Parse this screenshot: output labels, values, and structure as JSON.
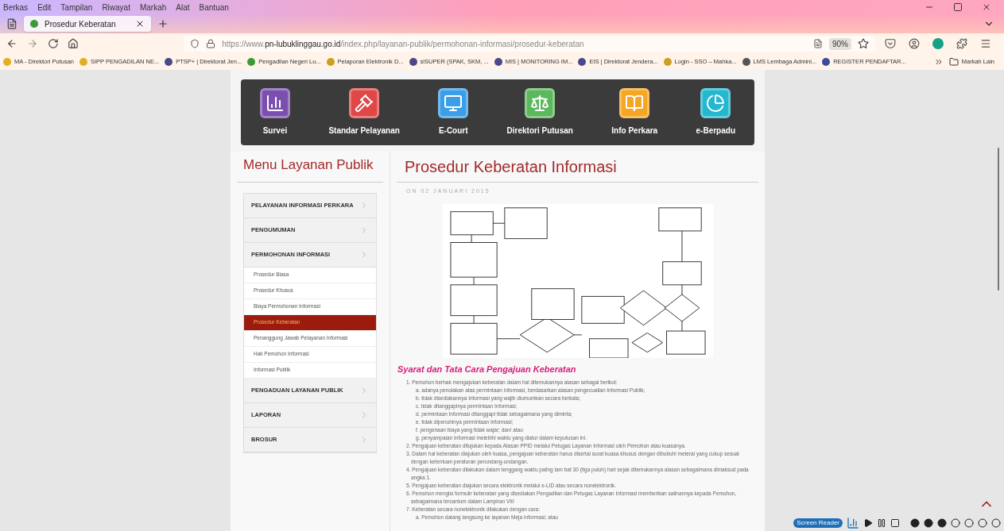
{
  "browser": {
    "menu_bar": [
      "Berkas",
      "Edit",
      "Tampilan",
      "Riwayat",
      "Markah",
      "Alat",
      "Bantuan"
    ],
    "tab": {
      "title": "Prosedur Keberatan",
      "selected": true
    },
    "url": {
      "scheme": "https://www.",
      "host": "pn-lubuklinggau.go.id",
      "path": "/index.php/layanan-publik/permohonan-informasi/prosedur-keberatan"
    },
    "zoom": "90%",
    "bookmarks": [
      {
        "label": "MA - Direktori Putusan",
        "color": "#e0b020"
      },
      {
        "label": "SIPP PENGADILAN NE...",
        "color": "#e0b020"
      },
      {
        "label": "PTSP+ | Direktorat Jen...",
        "color": "#4a4a8a"
      },
      {
        "label": "Pengadilan Negeri Lu...",
        "color": "#3a9a3a"
      },
      {
        "label": "Pelaporan Elektronik D...",
        "color": "#c9a020"
      },
      {
        "label": "siSUPER (SPAK, SKM, ...",
        "color": "#4a4a8a"
      },
      {
        "label": "MIS | MONITORING IM...",
        "color": "#4a4a8a"
      },
      {
        "label": "EIS | Direktorat Jendera...",
        "color": "#4a4a8a"
      },
      {
        "label": "Login - SSO – Mahka...",
        "color": "#c9a020"
      },
      {
        "label": "LMS Lembaga Admini...",
        "color": "#555555"
      },
      {
        "label": "REGISTER PENDAFTAR...",
        "color": "#3a4aa0"
      }
    ],
    "bookmarks_folder": "Markah Lain"
  },
  "quick_links": [
    {
      "label": "Survei",
      "color": "#7b4fae",
      "kind": "chart"
    },
    {
      "label": "Standar Pelayanan",
      "color": "#e04848",
      "kind": "gavel"
    },
    {
      "label": "E-Court",
      "color": "#3a9ee8",
      "kind": "monitor"
    },
    {
      "label": "Direktori Putusan",
      "color": "#5cb85c",
      "kind": "scale"
    },
    {
      "label": "Info Perkara",
      "color": "#f5a623",
      "kind": "book"
    },
    {
      "label": "e-Berpadu",
      "color": "#22b8d0",
      "kind": "pie"
    }
  ],
  "sidebar": {
    "title": "Menu Layanan Publik",
    "items": [
      {
        "label": "PELAYANAN INFORMASI PERKARA"
      },
      {
        "label": "PENGUMUMAN"
      },
      {
        "label": "PERMOHONAN INFORMASI",
        "children": [
          {
            "label": "Prosedur Biasa",
            "selected": false
          },
          {
            "label": "Prosedur Khusus",
            "selected": false
          },
          {
            "label": "Biaya Permohonan Informasi",
            "selected": false
          },
          {
            "label": "Prosedur Keberatan",
            "selected": true
          },
          {
            "label": "Penanggung Jawab Pelayanan Informasi",
            "selected": false
          },
          {
            "label": "Hak Pemohon Informasi",
            "selected": false
          },
          {
            "label": "Informasi Publik",
            "selected": false
          }
        ]
      },
      {
        "label": "PENGADUAN LAYANAN PUBLIK"
      },
      {
        "label": "LAPORAN"
      },
      {
        "label": "BROSUR"
      }
    ]
  },
  "article": {
    "title": "Prosedur Keberatan Informasi",
    "date": "ON 02 JANUARI 2015",
    "section_title": "Syarat dan Tata Cara Pengajuan Keberatan",
    "list": [
      {
        "text": "1. Pemohon berhak mengajukan keberatan dalam hal ditemukannya alasan sebagai berikut:",
        "children": [
          "a. adanya penolakan atas permintaan Informasi, berdasarkan alasan pengecualian Informasi Publik;",
          "b. tidak disediakannya Informasi yang wajib diumumkan secara berkala;",
          "c. tidak ditanggapinya permintaan Informasi;",
          "d. permintaan Informasi ditanggapi tidak sebagaimana yang diminta;",
          "e. tidak dipenuhinya permintaan Informasi;",
          "f. pengenaan biaya yang tidak wajar; dan/ atau",
          "g. penyampaian Informasi melebihi waktu yang diatur dalam keputusan ini."
        ]
      },
      {
        "text": "2. Pengajuan keberatan ditujukan kepada Atasan PPID melalui Petugas Layanan Informasi oleh Pemohon atau kuasanya."
      },
      {
        "text": "3. Dalam hal keberatan diajukan oleh kuasa, pengajuan keberatan harus disertai surat kuasa khusus dengan dibubuhi meterai yang cukup sesuai dengan ketentuan peraturan perundang-undangan."
      },
      {
        "text": "4. Pengajuan keberatan dilakukan dalam tenggang waktu paling lam bat 30 (tiga puluh) hari sejak ditemukannya alasan sebagaimana dimaksud pada angka 1."
      },
      {
        "text": "5. Pengajuan keberatan diajukan secara elektronik melalui e-LID atau secara nonelektronik."
      },
      {
        "text": "6. Pemohon mengisi formulir keberatan yang disediakan Pengadilan dan Petugas Layanan Informasi memberikan salinannya kepada Pemohon, sebagaimana tercantum dalam Lampiran VIII"
      },
      {
        "text": "7. Keberatan secara nonelektronik dilakukan dengan cara:",
        "children": [
          "a. Pemohon datang langsung ke layanan Meja Informasi; atau"
        ]
      }
    ]
  },
  "screen_reader": {
    "label": "Screen Reader"
  }
}
